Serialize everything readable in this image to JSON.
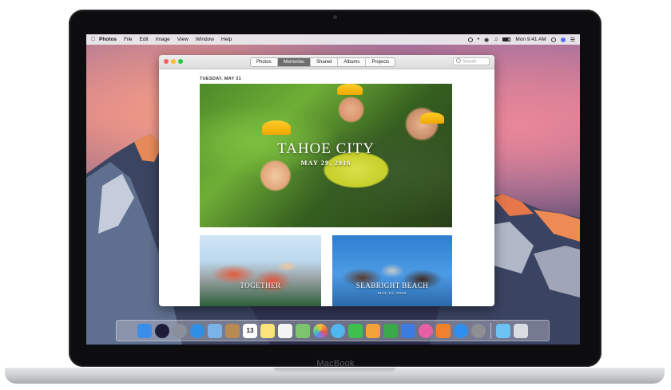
{
  "device": {
    "brand_label": "MacBook"
  },
  "menubar": {
    "apple": "",
    "items": [
      "Photos",
      "File",
      "Edit",
      "Image",
      "View",
      "Window",
      "Help"
    ],
    "clock": "Mon 9:41 AM"
  },
  "window": {
    "tabs": [
      "Photos",
      "Memories",
      "Shared",
      "Albums",
      "Projects"
    ],
    "active_tab": "Memories",
    "search_placeholder": "Search"
  },
  "memories": {
    "date_header": "TUESDAY, MAY 31",
    "featured": {
      "title": "TAHOE CITY",
      "date": "MAY 29, 2016"
    },
    "cards": [
      {
        "title": "TOGETHER",
        "subtitle": ""
      },
      {
        "title": "SEABRIGHT BEACH",
        "subtitle": "MAY 14, 2016"
      }
    ]
  },
  "dock": {
    "icons": [
      {
        "name": "finder-icon",
        "color": "#3b8ee8"
      },
      {
        "name": "siri-icon",
        "color": "#1d1d3a"
      },
      {
        "name": "launchpad-icon",
        "color": "#8a8f99"
      },
      {
        "name": "safari-icon",
        "color": "#2f8fe6"
      },
      {
        "name": "mail-icon",
        "color": "#7bb2e8"
      },
      {
        "name": "contacts-icon",
        "color": "#b78a55"
      },
      {
        "name": "calendar-icon",
        "color": "#ffffff"
      },
      {
        "name": "notes-icon",
        "color": "#fbe27a"
      },
      {
        "name": "reminders-icon",
        "color": "#f4f4f4"
      },
      {
        "name": "maps-icon",
        "color": "#7cc46e"
      },
      {
        "name": "photos-icon",
        "color": "#f7f7f7"
      },
      {
        "name": "messages-icon",
        "color": "#4fb6f0"
      },
      {
        "name": "facetime-icon",
        "color": "#3fbf4c"
      },
      {
        "name": "pages-icon",
        "color": "#f2a33a"
      },
      {
        "name": "numbers-icon",
        "color": "#3aa94a"
      },
      {
        "name": "keynote-icon",
        "color": "#3d7be0"
      },
      {
        "name": "itunes-icon",
        "color": "#e85fa6"
      },
      {
        "name": "ibooks-icon",
        "color": "#f2812f"
      },
      {
        "name": "app-store-icon",
        "color": "#2e8ff0"
      },
      {
        "name": "system-preferences-icon",
        "color": "#8d8f94"
      }
    ],
    "trailing": [
      {
        "name": "folder-icon",
        "color": "#6cc2f2"
      },
      {
        "name": "trash-icon",
        "color": "#d9dde2"
      }
    ],
    "calendar_day": "13"
  }
}
